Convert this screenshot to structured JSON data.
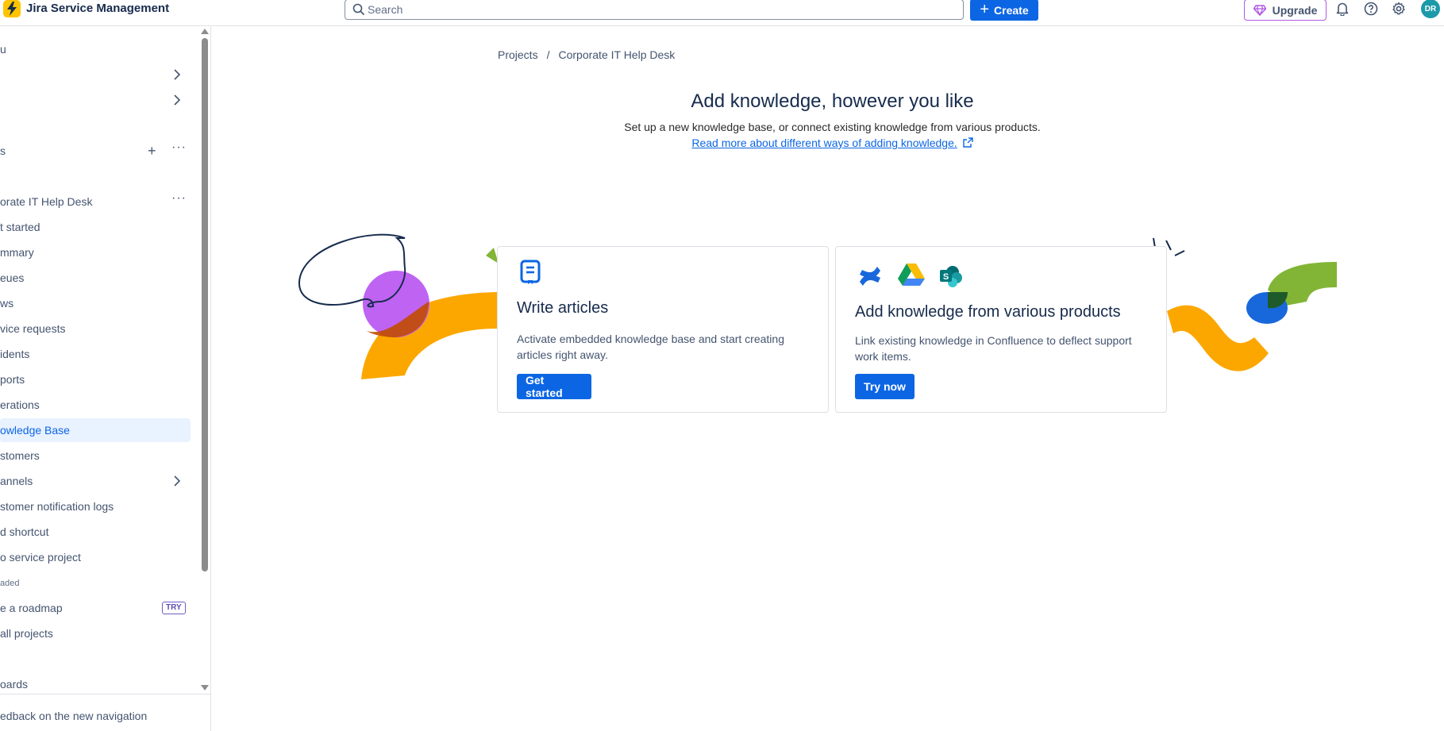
{
  "topbar": {
    "app_name": "Jira Service Management",
    "search_placeholder": "Search",
    "create_label": "Create",
    "upgrade_label": "Upgrade",
    "avatar_initials": "DR",
    "icons": [
      "notifications-icon",
      "help-icon",
      "settings-icon"
    ]
  },
  "sidebar": {
    "items": [
      {
        "label": "u"
      },
      {
        "label": ""
      },
      {
        "label": ""
      },
      {
        "label": "s"
      },
      {
        "label": "orate IT Help Desk"
      },
      {
        "label": "t started"
      },
      {
        "label": "mmary"
      },
      {
        "label": "eues"
      },
      {
        "label": "ws"
      },
      {
        "label": "vice requests"
      },
      {
        "label": "idents"
      },
      {
        "label": "ports"
      },
      {
        "label": "erations"
      },
      {
        "label": "owledge Base"
      },
      {
        "label": "stomers"
      },
      {
        "label": "annels"
      },
      {
        "label": "stomer notification logs"
      },
      {
        "label": "d shortcut"
      },
      {
        "label": "o service project"
      },
      {
        "label": "aded"
      },
      {
        "label": "e a roadmap"
      },
      {
        "label": "all projects"
      },
      {
        "label": "oards"
      }
    ],
    "try_badge": "TRY",
    "feedback_label": "edback on the new navigation"
  },
  "main": {
    "breadcrumb": {
      "root": "Projects",
      "separator": "/",
      "current": "Corporate IT Help Desk"
    },
    "title": "Add knowledge, however you like",
    "subtitle": "Set up a new knowledge base, or connect existing knowledge from various products.",
    "learn_more": "Read more about different ways of adding knowledge.",
    "cards": [
      {
        "title": "Write articles",
        "description": "Activate embedded knowledge base and start creating articles right away.",
        "button": "Get started",
        "icon": "knowledge-article-icon"
      },
      {
        "title": "Add knowledge from various products",
        "description": "Link existing knowledge in Confluence to deflect support work items.",
        "button": "Try now",
        "icons": [
          "confluence-icon",
          "google-drive-icon",
          "sharepoint-icon"
        ]
      }
    ]
  },
  "colors": {
    "primary": "#0c66e4",
    "upgrade_border": "#af59e1",
    "active_bg": "#e9f2ff",
    "avatar": "#1d9aaa",
    "logo": "#ffc400"
  }
}
